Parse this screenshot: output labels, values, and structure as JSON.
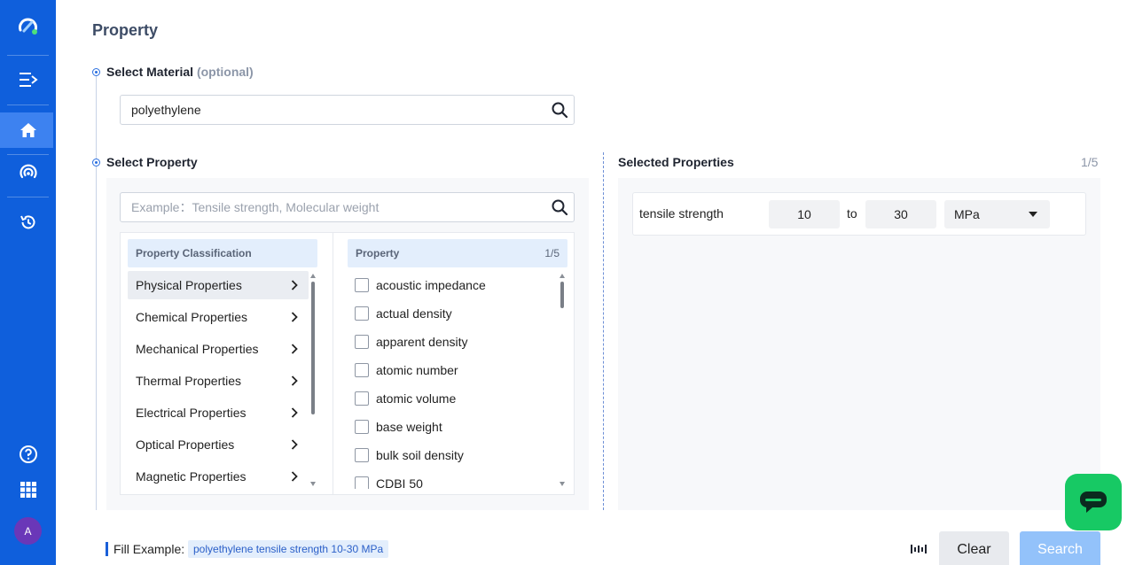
{
  "page": {
    "title": "Property"
  },
  "step_material": {
    "label": "Select Material",
    "optional": "(optional)",
    "input_value": "polyethylene"
  },
  "step_property": {
    "label": "Select Property",
    "search_placeholder": "Example：Tensile strength, Molecular weight"
  },
  "classification": {
    "header": "Property Classification",
    "items": [
      {
        "label": "Physical Properties",
        "selected": true
      },
      {
        "label": "Chemical Properties"
      },
      {
        "label": "Mechanical Properties"
      },
      {
        "label": "Thermal Properties"
      },
      {
        "label": "Electrical Properties"
      },
      {
        "label": "Optical Properties"
      },
      {
        "label": "Magnetic Properties"
      }
    ]
  },
  "property_list": {
    "header": "Property",
    "count": "1/5",
    "items": [
      "acoustic impedance",
      "actual density",
      "apparent density",
      "atomic number",
      "atomic volume",
      "base weight",
      "bulk soil density",
      "CDBI 50"
    ]
  },
  "selected_properties": {
    "title": "Selected Properties",
    "count": "1/5",
    "items": [
      {
        "name": "tensile strength",
        "from": "10",
        "to_label": "to",
        "to": "30",
        "unit": "MPa"
      }
    ]
  },
  "bottom": {
    "fill_example_label": "Fill Example:",
    "fill_example_value": "polyethylene tensile strength 10-30 MPa",
    "clear_label": "Clear",
    "search_label": "Search"
  },
  "sidebar": {
    "items": [
      "logo-icon",
      "expand-menu-icon",
      "home-icon",
      "broadcast-icon",
      "history-icon",
      "help-icon",
      "apps-grid-icon"
    ],
    "avatar_initial": "A"
  },
  "colors": {
    "sidebar": "#0f5fdc",
    "sidebar_active": "#3d82f0",
    "accent": "#1a5fd8",
    "search_button": "#93c2fa",
    "chat_fab": "#17c964"
  }
}
